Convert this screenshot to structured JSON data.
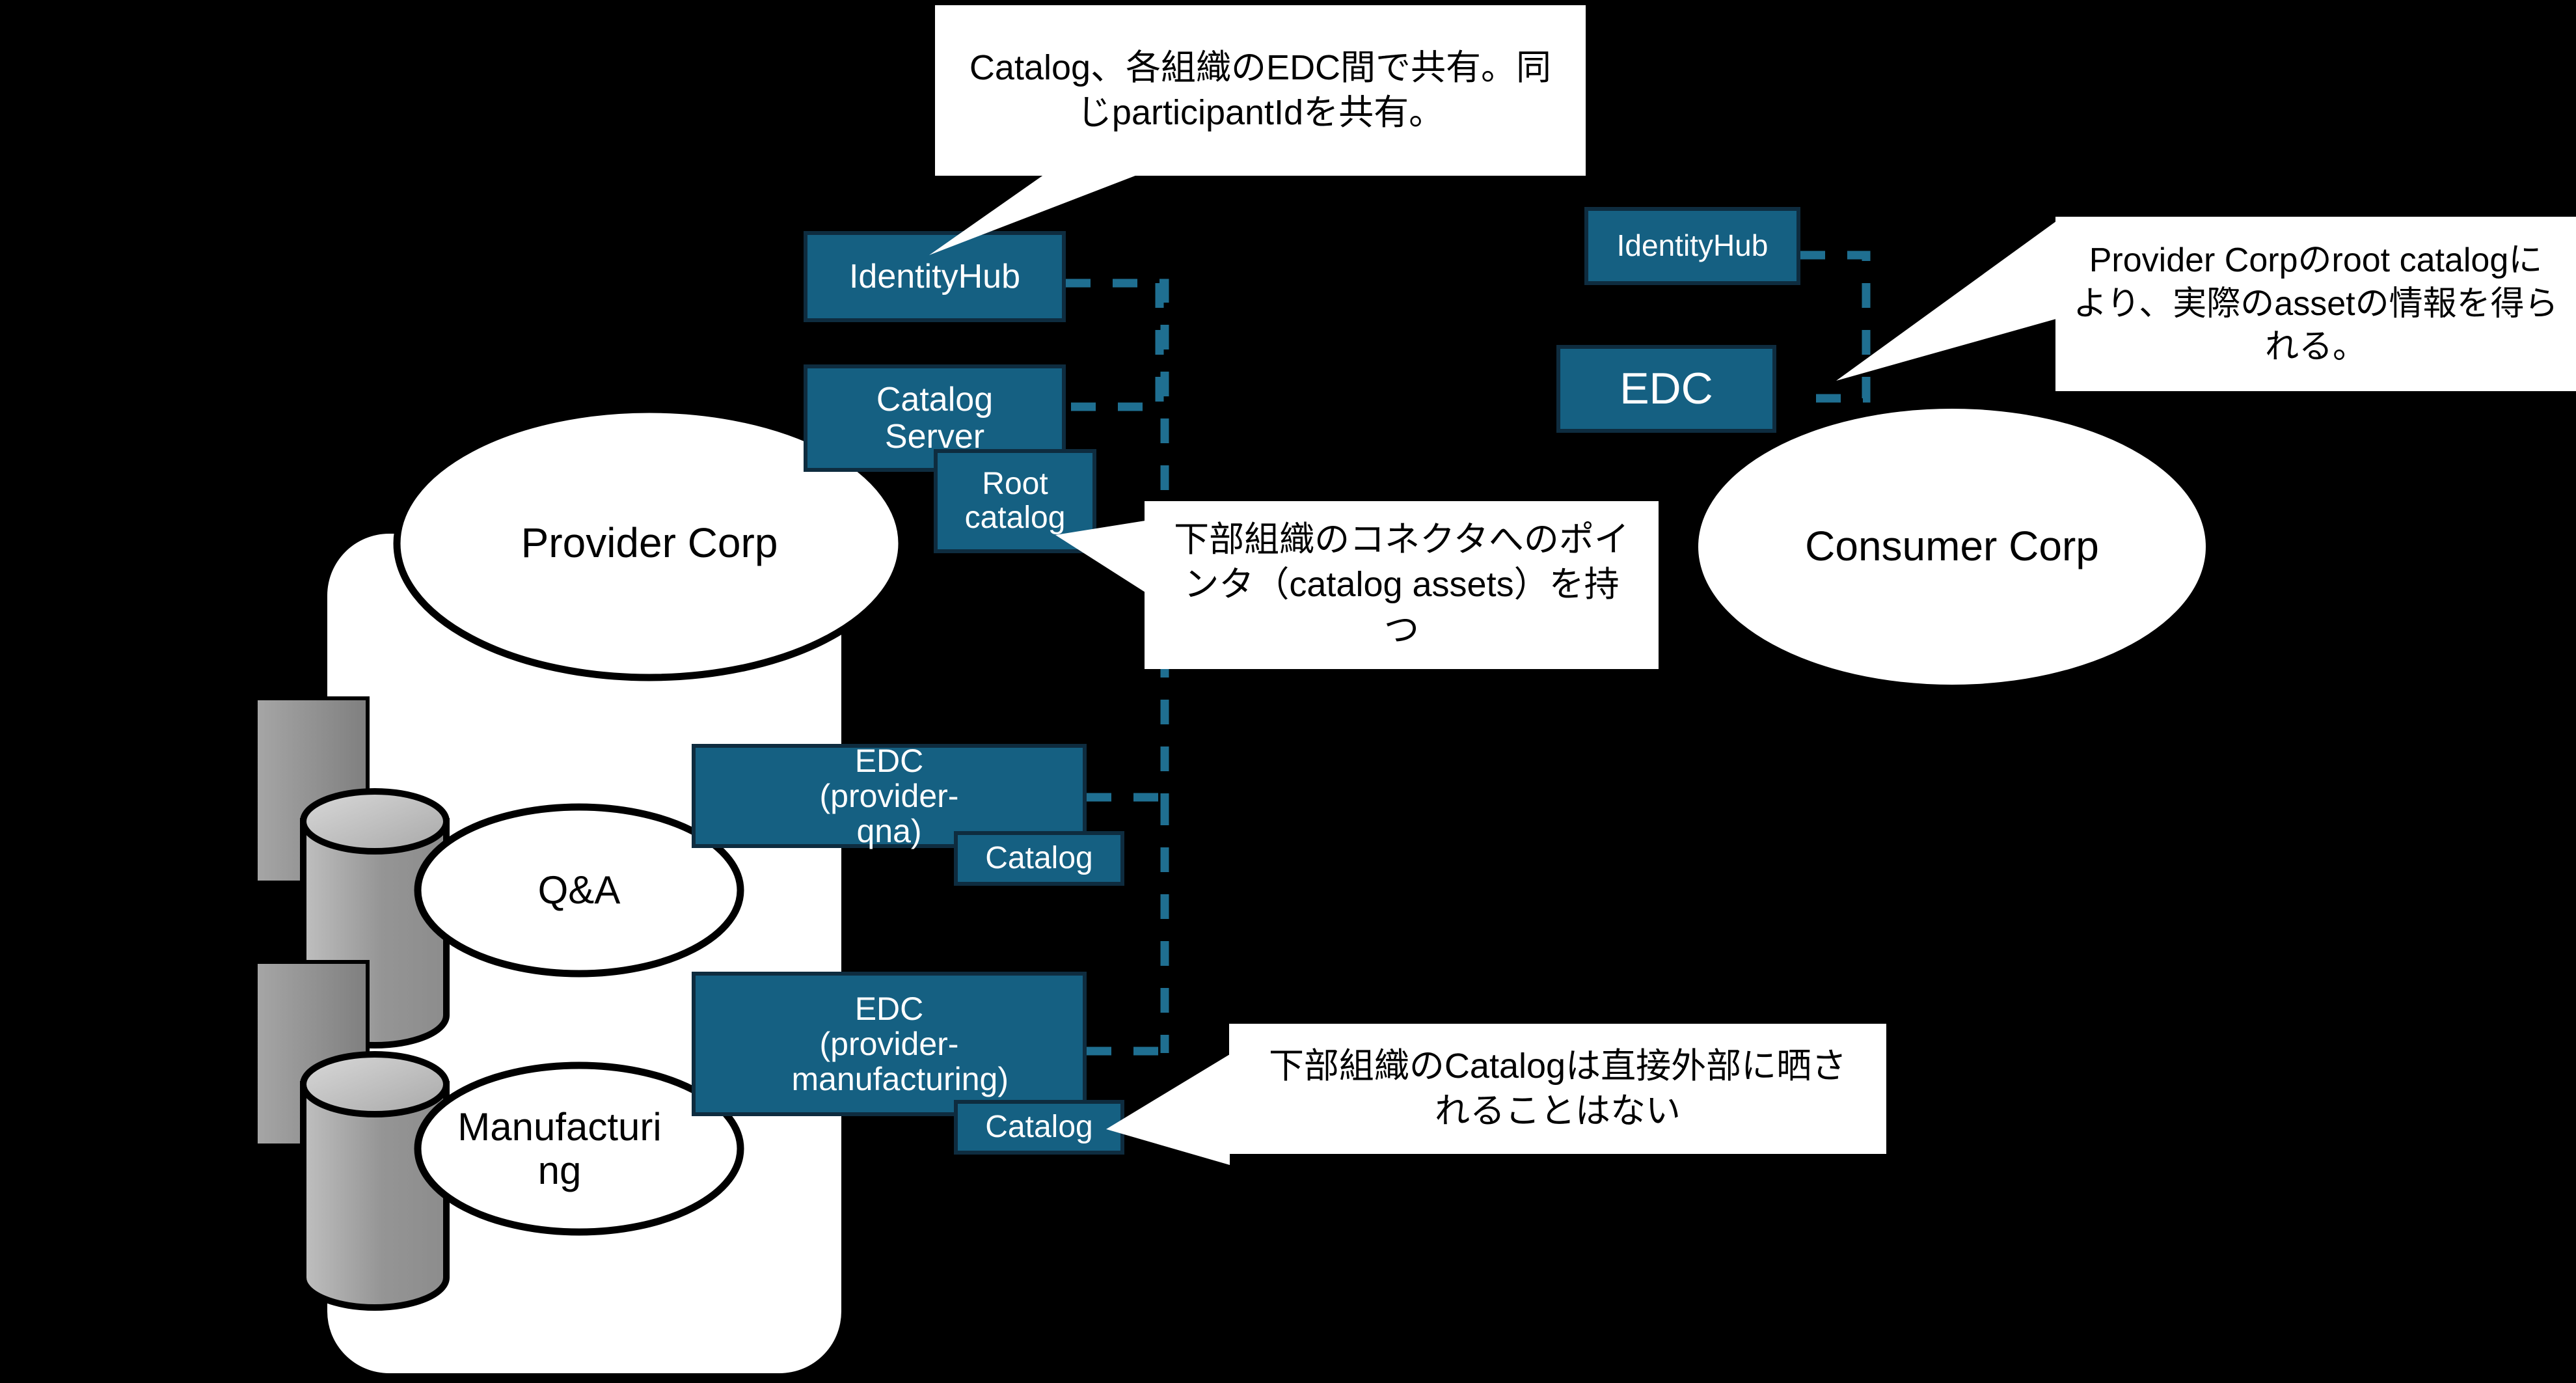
{
  "diagram": {
    "title": "EDC Catalog Federation Diagram",
    "background_color": "#000000",
    "node_fill": "#156082",
    "node_border": "#0E2C3F",
    "node_text_color": "#FFFFFF",
    "connector_color": "#1F6F91",
    "callout_fill": "#FFFFFF",
    "callout_text_color": "#000000"
  },
  "groups": {
    "provider": {
      "container_label": "",
      "ellipse_label": "Provider Corp",
      "sub_units": [
        {
          "label": "Q&A"
        },
        {
          "label": "Manufacturing"
        }
      ]
    },
    "consumer": {
      "ellipse_label": "Consumer Corp"
    }
  },
  "nodes": {
    "provider_identityhub": "IdentityHub",
    "provider_catalog_server": "Catalog Server",
    "provider_root_catalog": "Root catalog",
    "provider_qna_edc": "EDC (provider-qna)",
    "provider_qna_catalog": "Catalog",
    "provider_manufacturing_edc": "EDC (provider-manufacturing)",
    "provider_manufacturing_catalog": "Catalog",
    "consumer_identityhub": "IdentityHub",
    "consumer_edc": "EDC"
  },
  "callouts": {
    "catalog_sharing": "Catalog、各組織のEDC間で共有。同じparticipantIdを共有。",
    "root_catalog_assets": "Provider Corpのroot catalogにより、実際のassetの情報を得られる。",
    "pointer_catalog_assets": "下部組織のコネクタへのポインタ（catalog assets）を持つ",
    "no_direct_exposure": "下部組織のCatalogは直接外部に晒されることはない"
  },
  "icons": {
    "database_qna": "database-cylinder-icon",
    "database_manufacturing": "database-cylinder-icon",
    "document_qna": "document-page-icon",
    "document_manufacturing": "document-page-icon"
  }
}
